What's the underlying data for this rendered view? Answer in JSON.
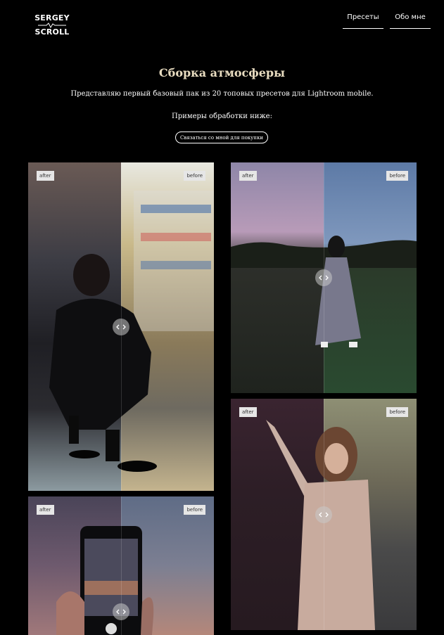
{
  "brand": {
    "line1": "SERGEY",
    "line2": "SCROLL"
  },
  "nav": {
    "presets": "Пресеты",
    "about": "Обо мне"
  },
  "hero": {
    "title": "Сборка атмосферы",
    "subtitle": "Представляю первый базовый пак из 20 топовых пресетов для Lightroom mobile.",
    "examples": "Примеры обработки ниже:",
    "cta": "Связаться со мной для покупки"
  },
  "gallery": {
    "label_after": "after",
    "label_before": "before"
  },
  "colors": {
    "title": "#e8dcc0",
    "background": "#000000"
  }
}
